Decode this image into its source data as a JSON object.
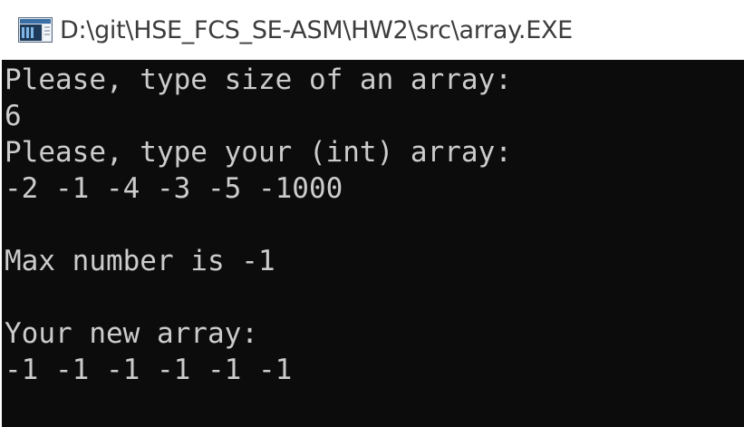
{
  "window": {
    "title": "D:\\git\\HSE_FCS_SE-ASM\\HW2\\src\\array.EXE",
    "icon": "console-app-icon"
  },
  "console": {
    "lines": [
      "Please, type size of an array:",
      "6",
      "Please, type your (int) array:",
      "-2 -1 -4 -3 -5 -1000",
      "",
      "Max number is -1",
      "",
      "Your new array:",
      "-1 -1 -1 -1 -1 -1"
    ],
    "background_color": "#0c0c0c",
    "text_color": "#cccccc"
  }
}
